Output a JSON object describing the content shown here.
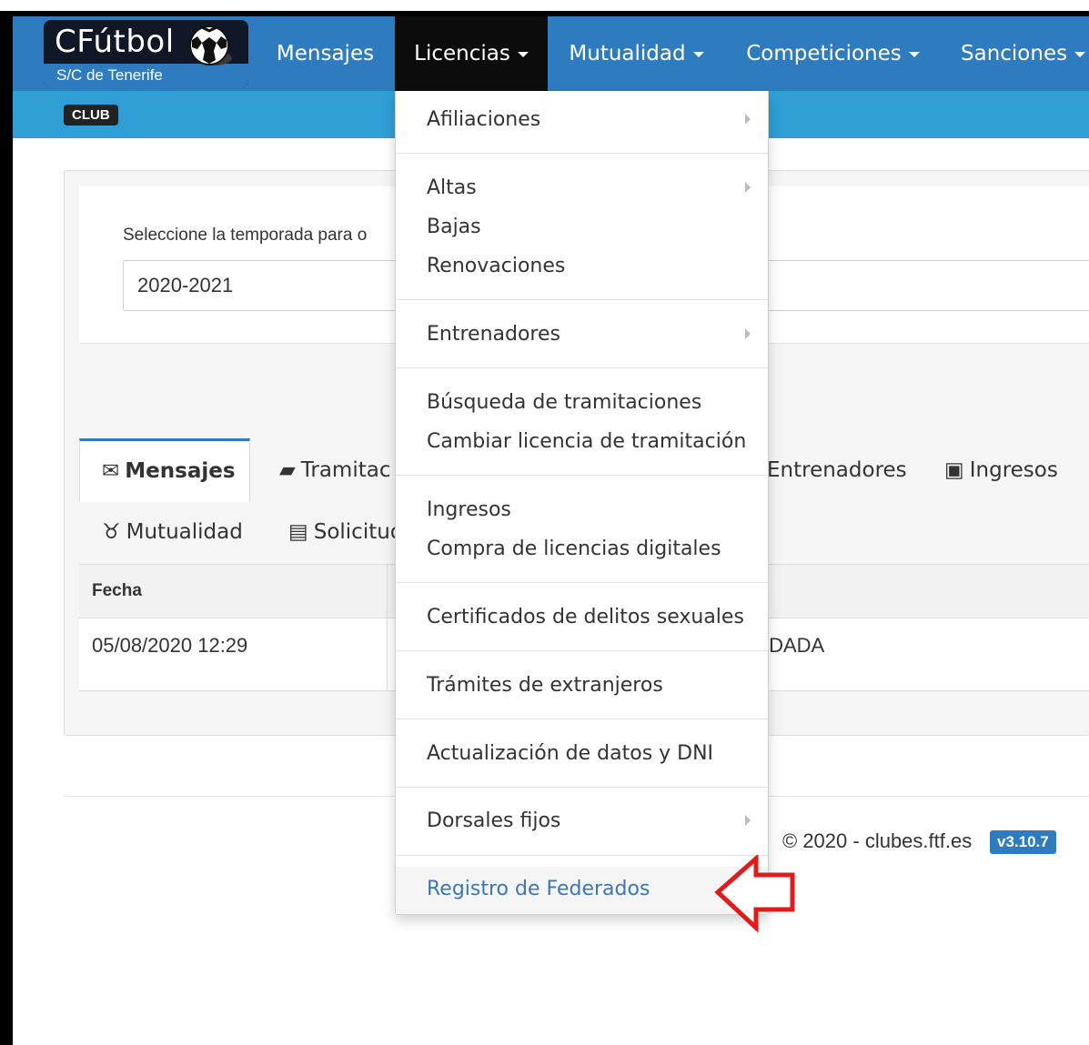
{
  "brand": {
    "title": "CFútbol",
    "subtitle": "S/C de Tenerife"
  },
  "nav": {
    "items": [
      {
        "label": "Mensajes",
        "has_caret": false
      },
      {
        "label": "Licencias",
        "has_caret": true,
        "active": true
      },
      {
        "label": "Mutualidad",
        "has_caret": true
      },
      {
        "label": "Competiciones",
        "has_caret": true
      },
      {
        "label": "Sanciones",
        "has_caret": true
      }
    ]
  },
  "subbar": {
    "badge": "CLUB"
  },
  "season": {
    "label": "Seleccione la temporada para o",
    "selected": "2020-2021"
  },
  "tabs": {
    "mensajes": "Mensajes",
    "tramitaciones": "Tramitac",
    "entrenadores": "Entrenadores",
    "ingresos": "Ingresos",
    "mutualidad": "Mutualidad",
    "solicitudes": "Solicitud"
  },
  "table": {
    "header_fecha": "Fecha",
    "row_date": "05/08/2020 12:29",
    "row_state": "IDADA"
  },
  "footer": {
    "text": "© 2020 - clubes.ftf.es",
    "version": "v3.10.7"
  },
  "dropdown": {
    "afiliaciones": "Afiliaciones",
    "altas": "Altas",
    "bajas": "Bajas",
    "renovaciones": "Renovaciones",
    "entrenadores": "Entrenadores",
    "busqueda": "Búsqueda de tramitaciones",
    "cambiar": "Cambiar licencia de tramitación",
    "ingresos": "Ingresos",
    "compra": "Compra de licencias digitales",
    "certificados": "Certificados de delitos sexuales",
    "tramites": "Trámites de extranjeros",
    "actualizacion": "Actualización de datos y DNI",
    "dorsales": "Dorsales fijos",
    "registro": "Registro de Federados"
  },
  "colors": {
    "navbar": "#2f7bbf",
    "subbar": "#2f9fd6",
    "active_nav": "#0c0c0c",
    "link": "#3b77b8",
    "annotation_arrow": "#e01b1b"
  },
  "icons": [
    "envelope-icon",
    "folder-open-icon",
    "money-icon",
    "stethoscope-icon",
    "credit-card-icon",
    "soccer-ball-icon"
  ]
}
